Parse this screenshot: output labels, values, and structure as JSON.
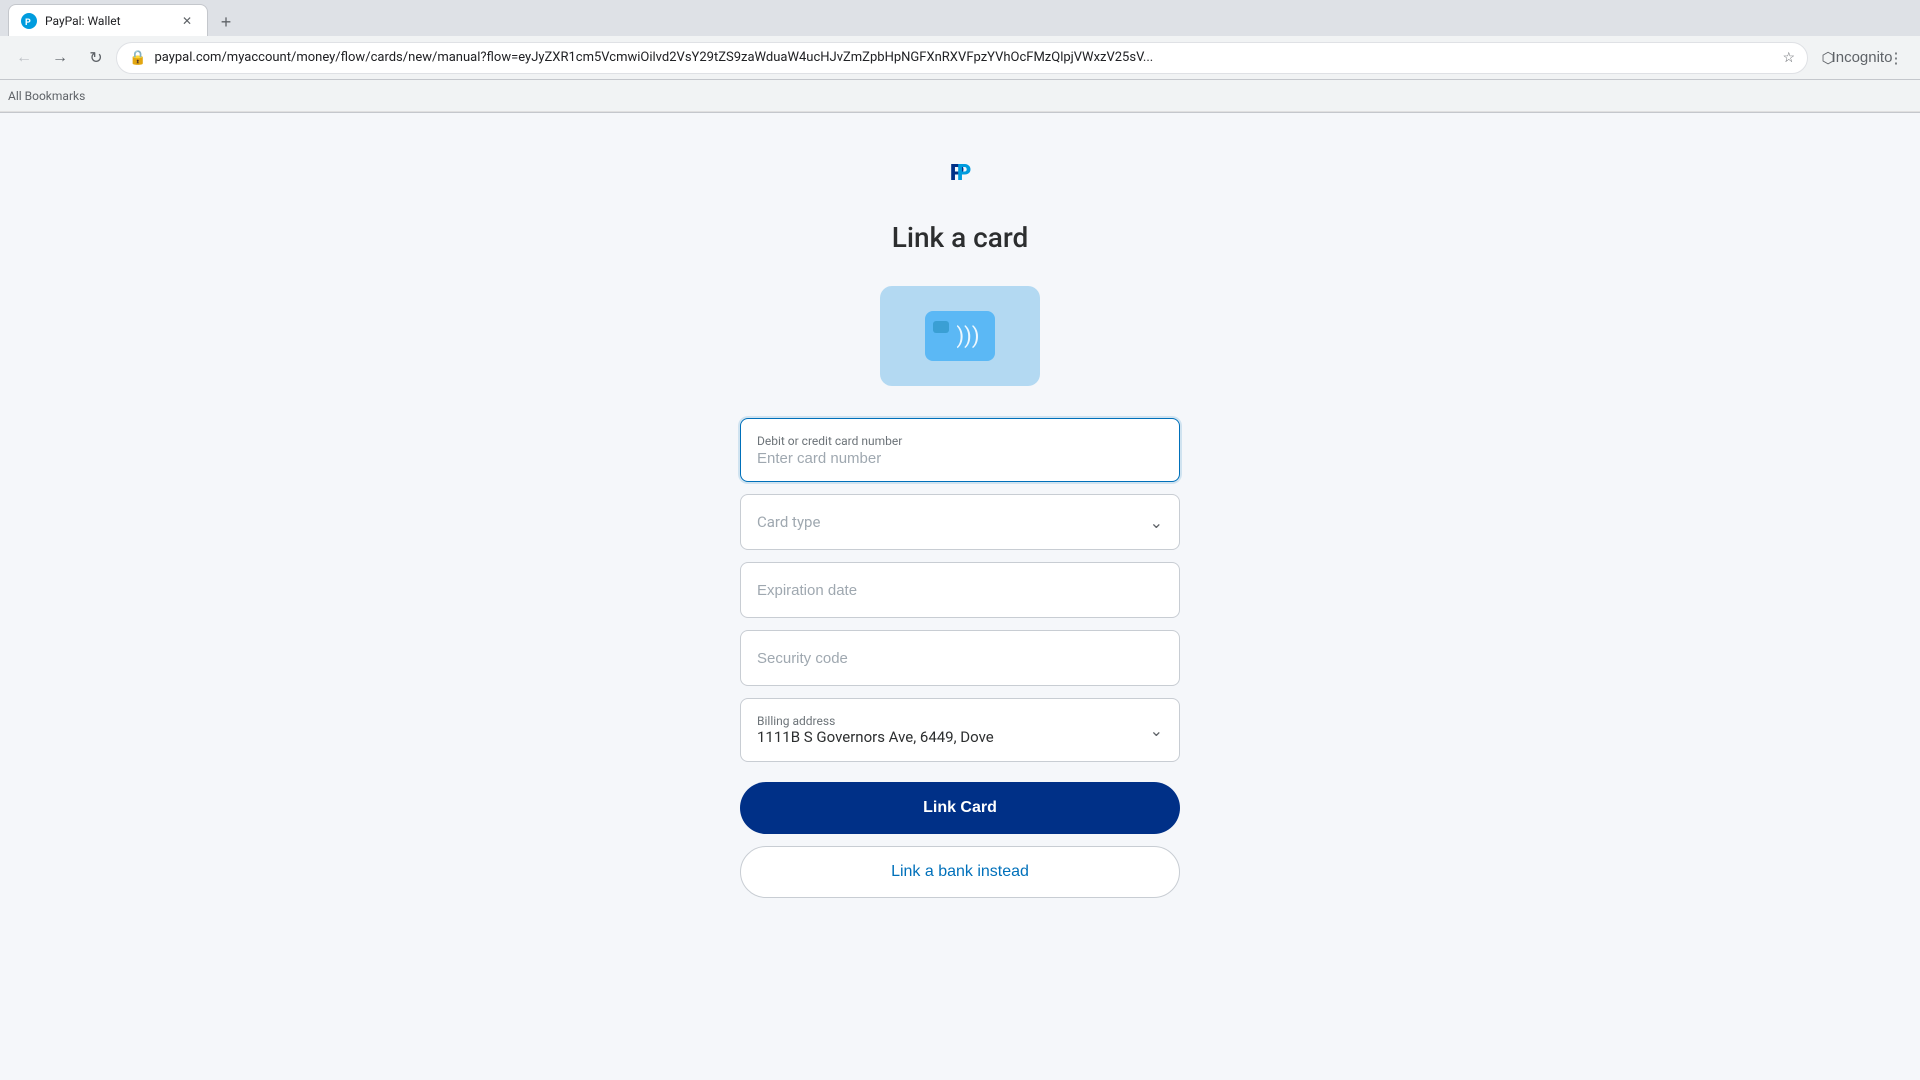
{
  "browser": {
    "tab": {
      "favicon_color": "#003087",
      "title": "PayPal: Wallet"
    },
    "url": "paypal.com/myaccount/money/flow/cards/new/manual?flow=eyJyZXR1cm5VcmwiOilvd2VsY29tZS9zaWduaW4ucHJvZmZpbHpNGFXnRXVFpzYVhOcFMzQlpjVWxzV25sV...",
    "bookmarks_label": "All Bookmarks",
    "incognito_label": "Incognito"
  },
  "page": {
    "title": "Link a card",
    "paypal_logo_alt": "PayPal logo"
  },
  "form": {
    "card_number": {
      "label": "Debit or credit card number",
      "placeholder": "Enter card number"
    },
    "card_type": {
      "label": "Card type",
      "placeholder": "Card type"
    },
    "expiration_date": {
      "label": "",
      "placeholder": "Expiration date"
    },
    "security_code": {
      "label": "",
      "placeholder": "Security code"
    },
    "billing_address": {
      "label": "Billing address",
      "value": "1111B S Governors Ave, 6449, Dove"
    },
    "btn_link_card": "Link Card",
    "btn_link_bank": "Link a bank instead"
  }
}
